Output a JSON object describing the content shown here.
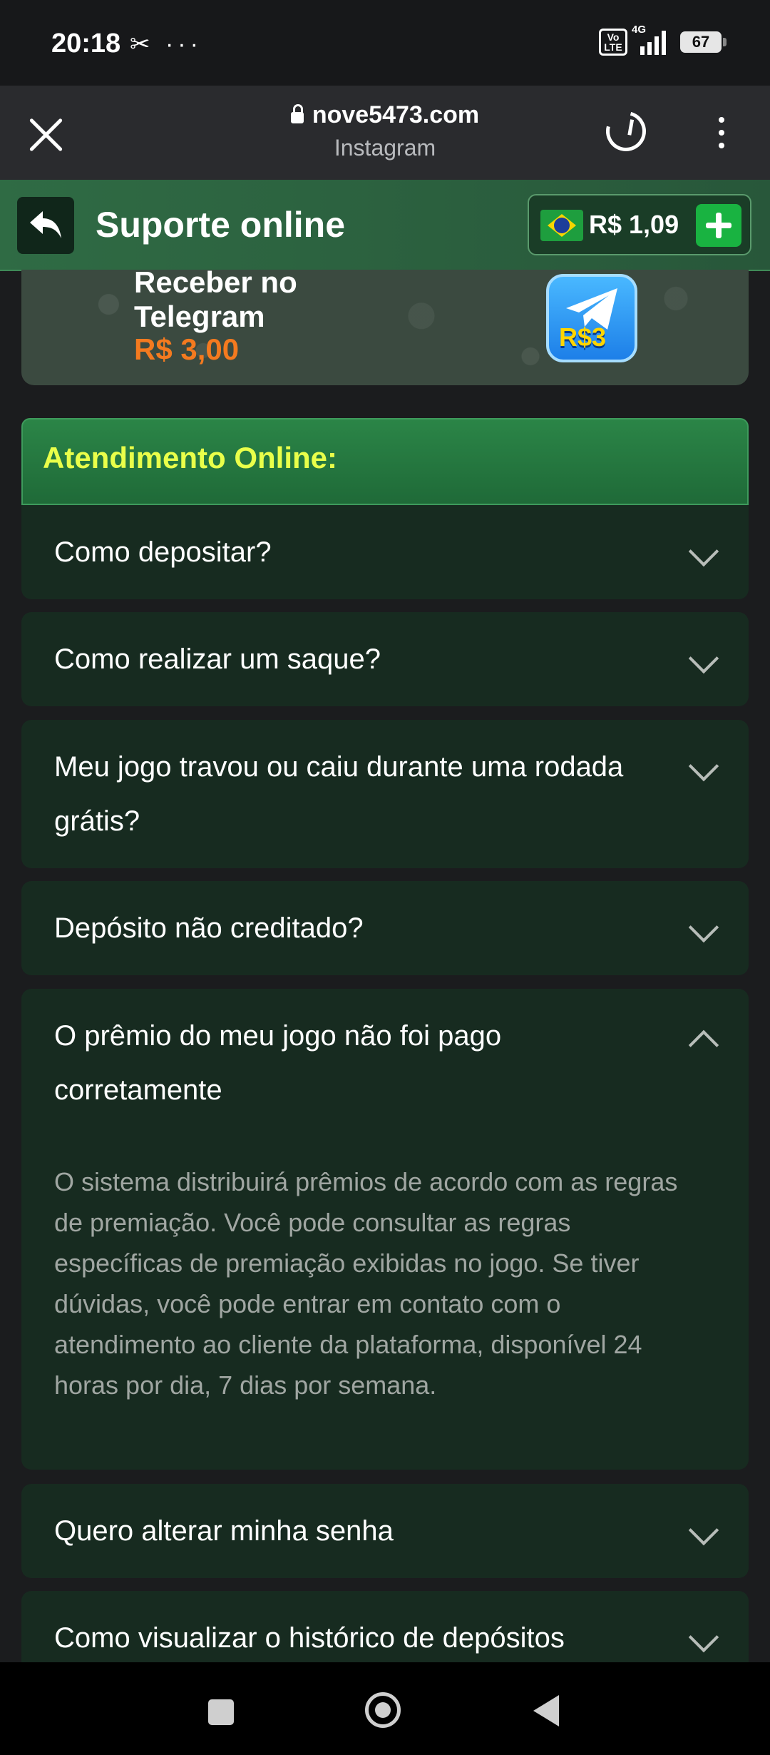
{
  "status_bar": {
    "time": "20:18",
    "left_icons": [
      "missed-call-icon",
      "more-icon"
    ],
    "volte": "Vo LTE",
    "network": "4G",
    "battery": "67"
  },
  "browser": {
    "domain": "nove5473.com",
    "subtitle": "Instagram"
  },
  "header": {
    "title": "Suporte online",
    "balance": "R$ 1,09",
    "brand_color": "#2f6b44"
  },
  "telegram_banner": {
    "title": "Receber no Telegram",
    "amount": "R$ 3,00",
    "badge": "R$3"
  },
  "section": {
    "title": "Atendimento Online:"
  },
  "faq": [
    {
      "question": "Como depositar?",
      "expanded": false
    },
    {
      "question": "Como realizar um saque?",
      "expanded": false
    },
    {
      "question": "Meu jogo travou ou caiu durante uma rodada grátis?",
      "expanded": false
    },
    {
      "question": "Depósito não creditado?",
      "expanded": false
    },
    {
      "question": "O prêmio do meu jogo não foi pago corretamente",
      "expanded": true,
      "answer": "O sistema distribuirá prêmios de acordo com as regras de premiação. Você pode consultar as regras específicas de premiação exibidas no jogo. Se tiver dúvidas, você pode entrar em contato com o atendimento ao cliente da plataforma, disponível 24 horas por dia, 7 dias por semana."
    },
    {
      "question": "Quero alterar minha senha",
      "expanded": false
    },
    {
      "question": "Como visualizar o histórico de depósitos",
      "expanded": false
    }
  ]
}
